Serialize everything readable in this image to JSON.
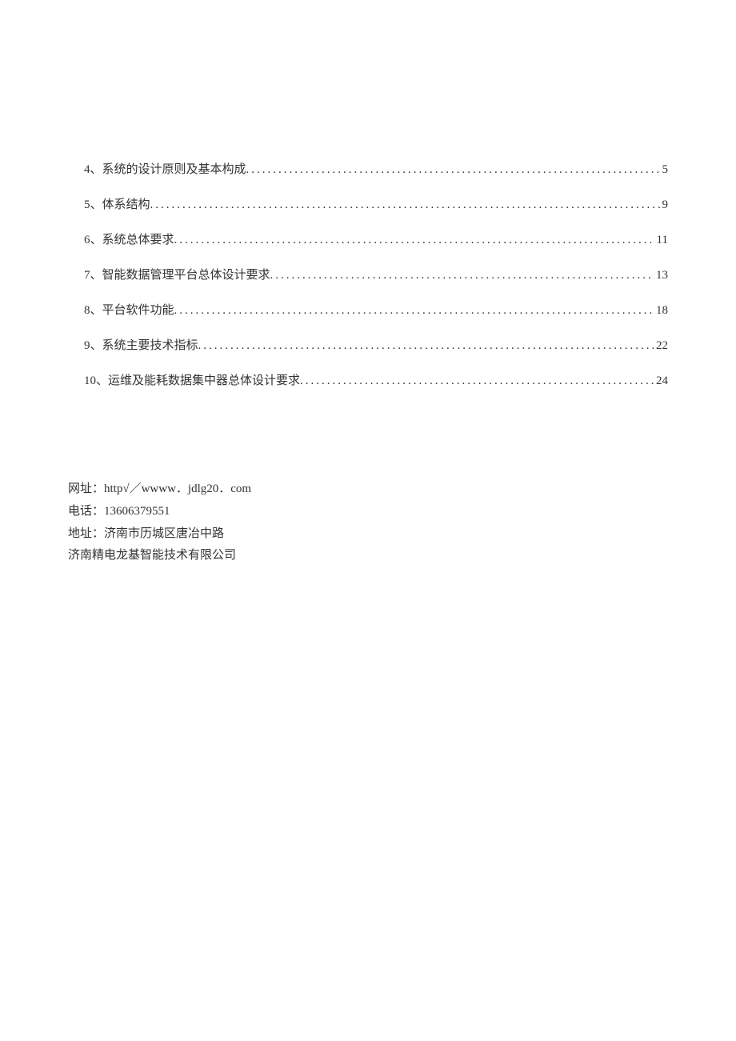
{
  "toc": [
    {
      "num": "4",
      "title": "系统的设计原则及基本构成",
      "page": "5"
    },
    {
      "num": "5",
      "title": "体系结构",
      "page": "9"
    },
    {
      "num": "6",
      "title": "系统总体要求",
      "page": "11"
    },
    {
      "num": "7",
      "title": "智能数据管理平台总体设计要求",
      "page": "13"
    },
    {
      "num": "8",
      "title": "平台软件功能",
      "page": "18"
    },
    {
      "num": "9",
      "title": "系统主要技术指标",
      "page": "22"
    },
    {
      "num": "10",
      "title": "运维及能耗数据集中器总体设计要求",
      "page": "24"
    }
  ],
  "contact": {
    "url_label": "网址：",
    "url_value": "http√／wwww．jdlg20．com",
    "phone_label": "电话：",
    "phone_value": "13606379551",
    "address_label": "地址：",
    "address_value": "济南市历城区唐冶中路",
    "company": "济南精电龙基智能技术有限公司"
  }
}
